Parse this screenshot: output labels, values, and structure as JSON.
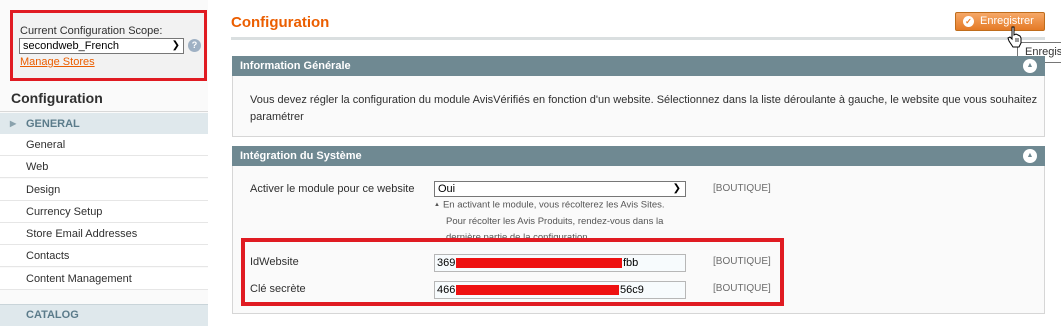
{
  "scope": {
    "label": "Current Configuration Scope:",
    "selected": "secondweb_French",
    "help_icon": "?",
    "manage_stores": "Manage Stores"
  },
  "sidebar": {
    "heading": "Configuration",
    "group_general": "GENERAL",
    "items": [
      {
        "label": "General"
      },
      {
        "label": "Web"
      },
      {
        "label": "Design"
      },
      {
        "label": "Currency Setup"
      },
      {
        "label": "Store Email Addresses"
      },
      {
        "label": "Contacts"
      },
      {
        "label": "Content Management"
      }
    ],
    "group_catalog": "CATALOG"
  },
  "main": {
    "title": "Configuration",
    "save_button": "Enregistrer",
    "tooltip": "Enregis"
  },
  "section_info": {
    "title": "Information Générale",
    "text": "Vous devez régler la configuration du module AvisVérifiés en fonction d'un website. Sélectionnez dans la liste déroulante à gauche, le website que vous souhaitez paramétrer"
  },
  "section_integration": {
    "title": "Intégration du Système",
    "activate": {
      "label": "Activer le module pour ce website",
      "value": "Oui",
      "scope": "[BOUTIQUE]",
      "note_line1": "En activant le module, vous récolterez les Avis Sites.",
      "note_line2": "Pour récolter les Avis Produits, rendez-vous dans la",
      "note_line3": "dernière partie de la configuration"
    },
    "idwebsite": {
      "label": "IdWebsite",
      "value_prefix": "369",
      "value_suffix": "fbb",
      "scope": "[BOUTIQUE]"
    },
    "secret": {
      "label": "Clé secrète",
      "value_prefix": "466",
      "value_suffix": "56c9",
      "scope": "[BOUTIQUE]"
    }
  },
  "colors": {
    "accent": "#eb5e00",
    "highlight": "#e01b22",
    "section_header": "#6f8992"
  }
}
